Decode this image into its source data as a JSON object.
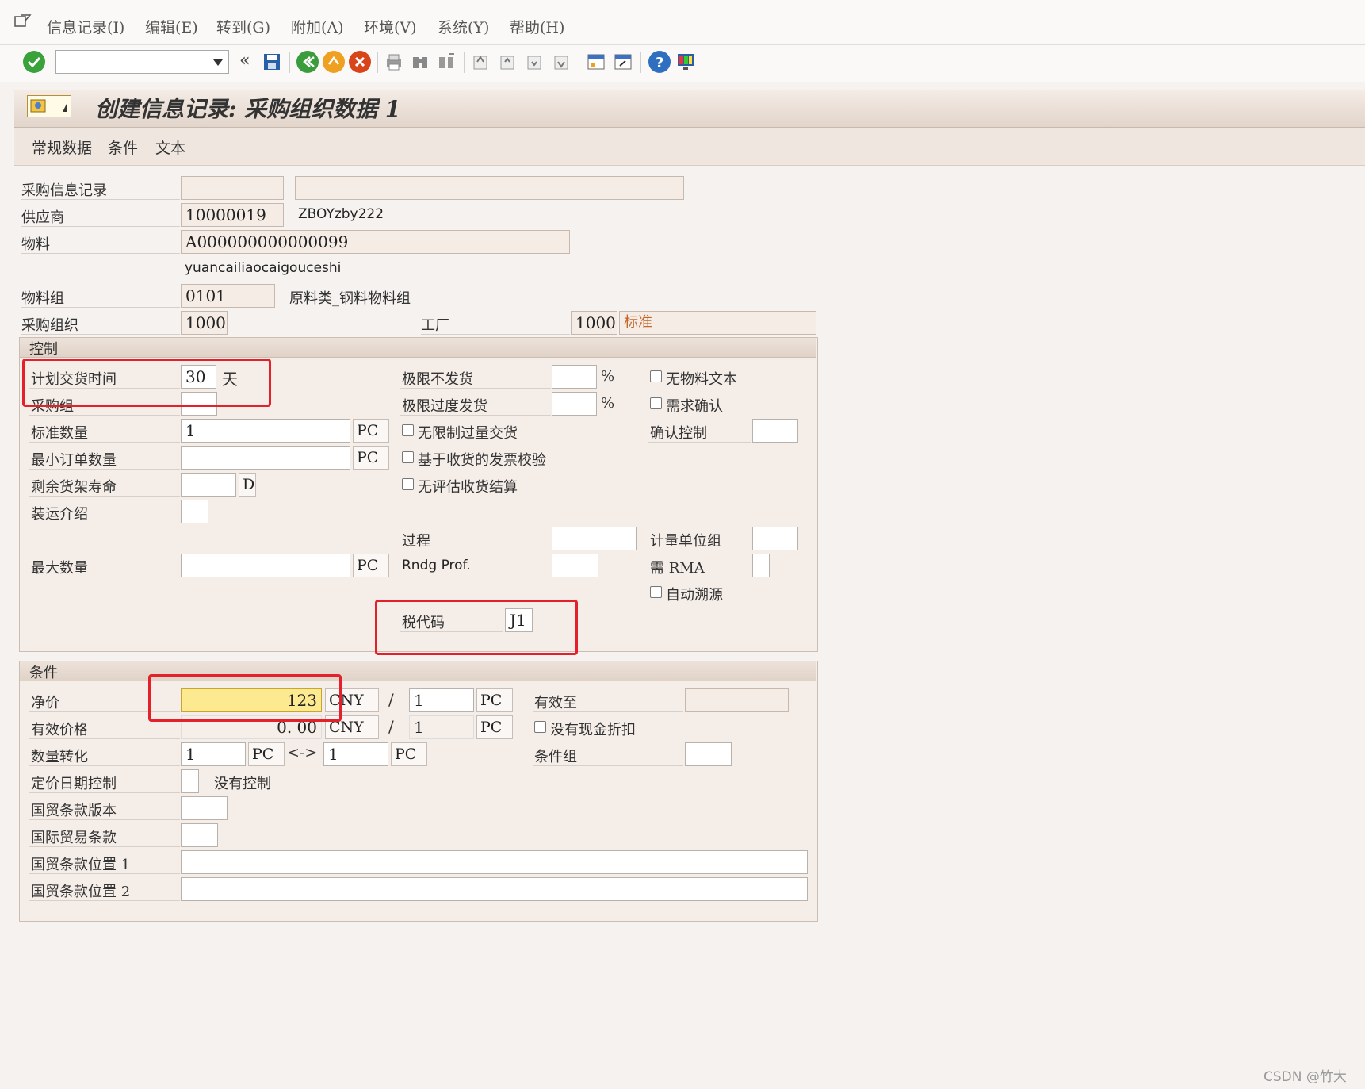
{
  "menu": [
    "信息记录(I)",
    "编辑(E)",
    "转到(G)",
    "附加(A)",
    "环境(V)",
    "系统(Y)",
    "帮助(H)"
  ],
  "title": "创建信息记录: 采购组织数据 1",
  "tabs": [
    "常规数据",
    "条件",
    "文本"
  ],
  "header": {
    "info_record_label": "采购信息记录",
    "vendor_label": "供应商",
    "vendor_value": "10000019",
    "vendor_name": "ZBOYzby222",
    "material_label": "物料",
    "material_value": "A000000000000099",
    "material_desc": "yuancailiaocaigouceshi",
    "material_group_label": "物料组",
    "material_group_value": "0101",
    "material_group_desc": "原料类_钢料物料组",
    "purch_org_label": "采购组织",
    "purch_org_value": "1000",
    "plant_label": "工厂",
    "plant_value": "1000",
    "plant_desc": "标准"
  },
  "control": {
    "title": "控制",
    "planned_delivery_label": "计划交货时间",
    "planned_delivery_value": "30",
    "planned_delivery_unit": "天",
    "purch_group_label": "采购组",
    "std_qty_label": "标准数量",
    "std_qty_value": "1",
    "std_qty_unit": "PC",
    "min_order_label": "最小订单数量",
    "min_order_unit": "PC",
    "shelf_life_label": "剩余货架寿命",
    "shelf_life_unit": "D",
    "shipping_label": "装运介绍",
    "max_qty_label": "最大数量",
    "max_qty_unit": "PC",
    "underdel_label": "极限不发货",
    "overdel_label": "极限过度发货",
    "percent": "%",
    "unlimited_label": "无限制过量交货",
    "gr_iv_label": "基于收货的发票校验",
    "no_eval_label": "无评估收货结算",
    "no_mat_text_label": "无物料文本",
    "ack_req_label": "需求确认",
    "conf_ctrl_label": "确认控制",
    "procedure_label": "过程",
    "rndg_label": "Rndg Prof.",
    "uom_group_label": "计量单位组",
    "rma_label": "需 RMA",
    "auto_source_label": "自动溯源",
    "tax_code_label": "税代码",
    "tax_code_value": "J1"
  },
  "conditions": {
    "title": "条件",
    "net_price_label": "净价",
    "net_price_value": "123",
    "currency": "CNY",
    "slash": "/",
    "per_value": "1",
    "per_unit": "PC",
    "valid_to_label": "有效至",
    "eff_price_label": "有效价格",
    "eff_price_value": "0. 00",
    "no_cash_disc_label": "没有现金折扣",
    "qty_conv_label": "数量转化",
    "qty_conv_left": "1",
    "qty_conv_left_unit": "PC",
    "qty_conv_arrow": "<->",
    "qty_conv_right": "1",
    "qty_conv_right_unit": "PC",
    "cond_group_label": "条件组",
    "pricing_date_label": "定价日期控制",
    "pricing_date_desc": "没有控制",
    "incoterms_ver_label": "国贸条款版本",
    "incoterms_label": "国际贸易条款",
    "incoterms_loc1_label": "国贸条款位置 1",
    "incoterms_loc2_label": "国贸条款位置 2"
  },
  "watermark": "CSDN @竹大",
  "colors": {
    "highlight": "#fde98f",
    "red": "#e4212b",
    "orange_text": "#c4652a"
  }
}
